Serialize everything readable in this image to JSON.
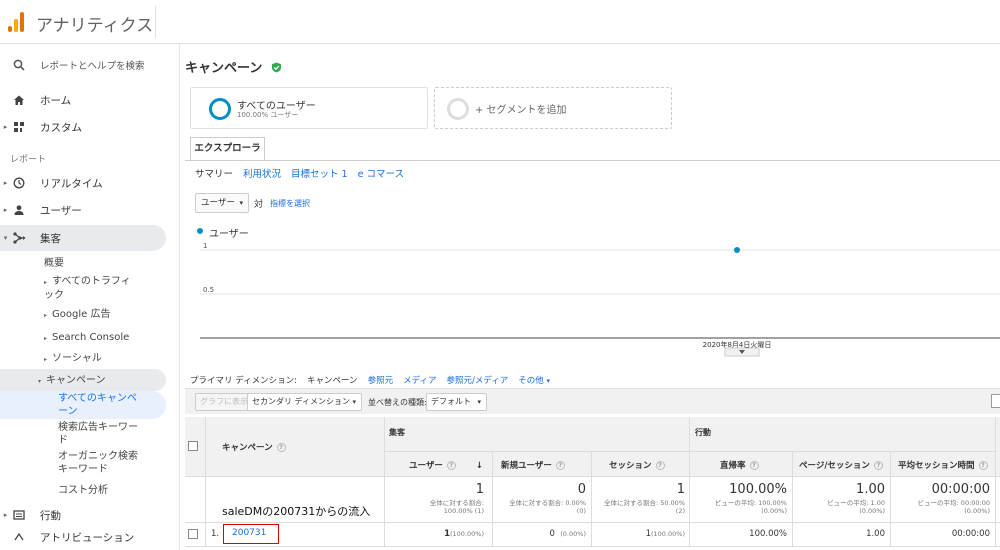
{
  "app": {
    "title": "アナリティクス"
  },
  "sidebar": {
    "search_label": "レポートとヘルプを検索",
    "home": "ホーム",
    "custom": "カスタム",
    "reports_section": "レポート",
    "realtime": "リアルタイム",
    "users": "ユーザー",
    "acquisition": "集客",
    "acq_sub": {
      "overview": "概要",
      "all_traffic": "すべてのトラフィック",
      "google_ads": "Google 広告",
      "search_console": "Search Console",
      "social": "ソーシャル",
      "campaigns": "キャンペーン",
      "campaign_sub": {
        "all_campaigns": "すべてのキャンペーン",
        "paid_keywords": "検索広告キーワード",
        "organic_keywords": "オーガニック検索キーワード",
        "cost_analysis": "コスト分析"
      }
    },
    "behavior": "行動",
    "attribution": "アトリビューション"
  },
  "page": {
    "title": "キャンペーン"
  },
  "segments": {
    "active": {
      "name": "すべてのユーザー",
      "sub": "100.00% ユーザー"
    },
    "add_label": "+ セグメントを追加"
  },
  "explorer": {
    "tab": "エクスプローラ",
    "subtabs": [
      "サマリー",
      "利用状況",
      "目標セット 1",
      "e コマース"
    ]
  },
  "chart_controls": {
    "metric": "ユーザー",
    "vs": "対",
    "pick": "指標を選択"
  },
  "chart_data": {
    "type": "scatter",
    "series": [
      {
        "name": "ユーザー",
        "x": [
          "2020年8月4日火曜日"
        ],
        "values": [
          1
        ]
      }
    ],
    "yticks": [
      "1",
      "0.5"
    ],
    "ylim": [
      0,
      1
    ],
    "x_label_text": "2020年8月4日火曜日",
    "color": "#058dc7"
  },
  "dimensions": {
    "label": "プライマリ ディメンション:",
    "current": "キャンペーン",
    "options": [
      "参照元",
      "メディア",
      "参照元/メディア",
      "その他"
    ]
  },
  "toolbar": {
    "plot_rows": "グラフに表示",
    "secondary_dim": "セカンダリ ディメンション",
    "sort_type_label": "並べ替えの種類:",
    "sort_value": "デフォルト"
  },
  "table": {
    "col_campaign": "キャンペーン",
    "group_acq": "集客",
    "group_behavior": "行動",
    "columns": [
      "ユーザー",
      "新規ユーザー",
      "セッション",
      "直帰率",
      "ページ/セッション",
      "平均セッション時間"
    ],
    "totals": [
      {
        "value": "1",
        "note1": "全体に対する割合:",
        "note2": "100.00% (1)"
      },
      {
        "value": "0",
        "note1": "全体に対する割合: 0.00%",
        "note2": "(0)"
      },
      {
        "value": "1",
        "note1": "全体に対する割合: 50.00%",
        "note2": "(2)"
      },
      {
        "value": "100.00%",
        "note1": "ビューの平均: 100.00%",
        "note2": "(0.00%)"
      },
      {
        "value": "1.00",
        "note1": "ビューの平均: 1.00",
        "note2": "(0.00%)"
      },
      {
        "value": "00:00:00",
        "note1": "ビューの平均: 00:00:00",
        "note2": "(0.00%)"
      }
    ],
    "annotation": "saleDMの200731からの流入",
    "rows": [
      {
        "index": "1.",
        "campaign": "200731",
        "users": "1",
        "users_pct": "(100.00%)",
        "new_users": "0",
        "new_users_pct": "(0.00%)",
        "sessions": "1",
        "sessions_pct": "(100.00%)",
        "bounce": "100.00%",
        "pages": "1.00",
        "duration": "00:00:00"
      }
    ]
  },
  "colors": {
    "accent": "#058dc7",
    "link": "#1a6ed8",
    "verified": "#34a853",
    "highlight_box": "#dd0000"
  }
}
